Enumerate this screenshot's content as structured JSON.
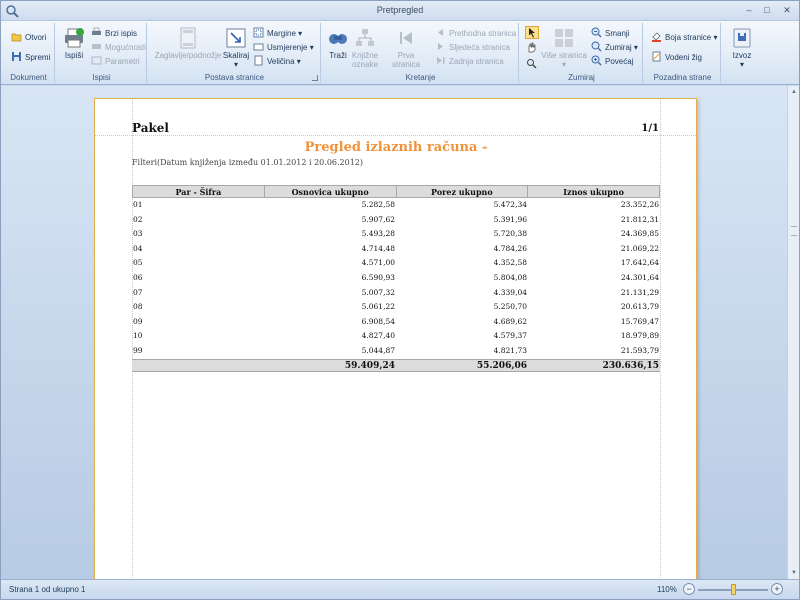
{
  "window": {
    "title": "Pretpregled",
    "minimize": "–",
    "maximize": "□",
    "close": "✕"
  },
  "ribbon": {
    "groups": {
      "document": "Dokument",
      "print": "Ispisi",
      "page_setup": "Postava stranice",
      "navigation": "Kretanje",
      "zoom": "Zumiraj",
      "background": "Pozadina strane",
      "export": ""
    },
    "open": "Otvori",
    "save": "Spremi",
    "print": "Ispiši",
    "quick_print": "Brzi ispis",
    "options": "Mogućnosti",
    "parameters": "Parametri",
    "header_footer": "Zaglavlje/podnožje",
    "scale": "Skaliraj",
    "margins": "Margine",
    "orientation": "Usmjerenje",
    "size": "Veličina",
    "find": "Traži",
    "bookmarks": "Knjižne oznake",
    "first_page": "Prva stranica",
    "previous_page": "Prethodna stranica",
    "next_page": "Sljedeća stranica",
    "last_page": "Zadnja stranica",
    "multiple_pages": "Više stranica",
    "zoom_out": "Smanji",
    "zoom": "Zumiraj",
    "zoom_in": "Povećaj",
    "page_color": "Boja stranice",
    "watermark": "Vodeni žig",
    "export": "Izvoz",
    "icons": [
      "open-icon",
      "save-icon",
      "print-icon",
      "quick-print-icon",
      "options-icon",
      "parameters-icon",
      "header-footer-icon",
      "scale-icon",
      "margins-icon",
      "orientation-icon",
      "size-icon",
      "find-icon",
      "bookmarks-icon",
      "first-page-icon",
      "previous-page-icon",
      "next-page-icon",
      "last-page-icon",
      "pointer-icon",
      "hand-icon",
      "magnifier-icon",
      "multiple-pages-icon",
      "zoom-out-icon",
      "zoom-icon",
      "zoom-in-icon",
      "page-color-icon",
      "watermark-icon",
      "export-icon"
    ]
  },
  "report": {
    "company": "Pakel",
    "page_number": "1/1",
    "title": "Pregled izlaznih računa -",
    "filter": "Filteri(Datum knjiženja između 01.01.2012 i 20.06.2012)",
    "columns": [
      "Par - Šifra",
      "Osnovica ukupno",
      "Porez ukupno",
      "Iznos ukupno"
    ],
    "rows": [
      [
        "01",
        "5.282,58",
        "5.472,34",
        "23.352,26"
      ],
      [
        "02",
        "5.907,62",
        "5.391,96",
        "21.812,31"
      ],
      [
        "03",
        "5.493,28",
        "5.720,38",
        "24.369,85"
      ],
      [
        "04",
        "4.714,48",
        "4.784,26",
        "21.069,22"
      ],
      [
        "05",
        "4.571,00",
        "4.352,58",
        "17.642,64"
      ],
      [
        "06",
        "6.590,93",
        "5.804,08",
        "24.301,64"
      ],
      [
        "07",
        "5.007,32",
        "4.339,04",
        "21.131,29"
      ],
      [
        "08",
        "5.061,22",
        "5.250,70",
        "20.613,79"
      ],
      [
        "09",
        "6.908,54",
        "4.689,62",
        "15.769,47"
      ],
      [
        "10",
        "4.827,40",
        "4.579,37",
        "18.979,89"
      ],
      [
        "99",
        "5.044,87",
        "4.821,73",
        "21.593,79"
      ]
    ],
    "totals": [
      "",
      "59.409,24",
      "55.206,06",
      "230.636,15"
    ]
  },
  "status": {
    "page_info": "Strana 1 od ukupno 1",
    "zoom_level": "110%",
    "zoom_out": "−",
    "zoom_in": "+",
    "zoom_slider_fraction": 0.52
  },
  "colors": {
    "title_orange": "#f0923a",
    "page_border": "#e2b04b",
    "ribbon_text": "#1e395b"
  }
}
